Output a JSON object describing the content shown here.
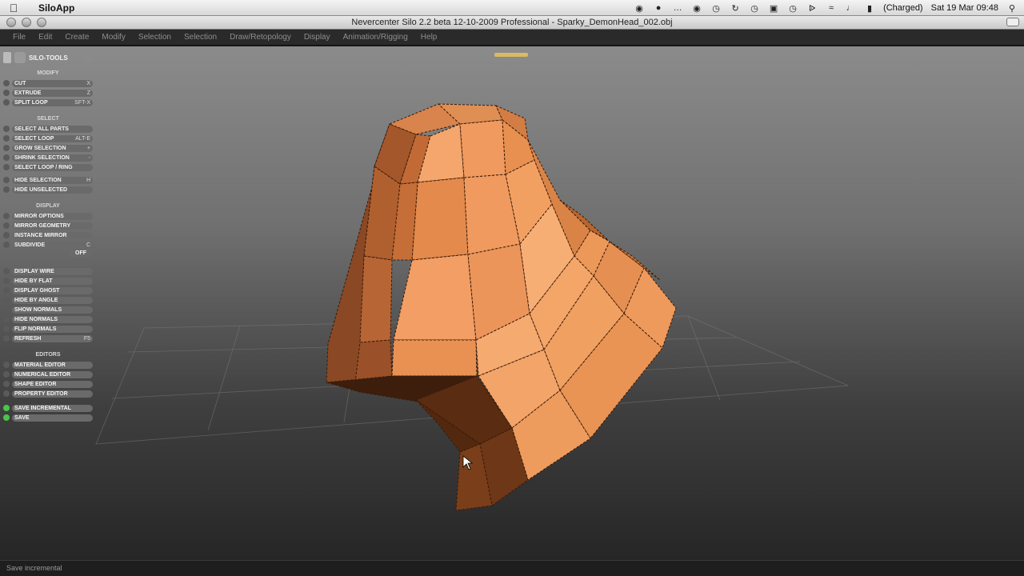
{
  "mac_menubar": {
    "app_name": "SiloApp",
    "status": {
      "battery": "(Charged)",
      "datetime": "Sat 19 Mar  09:48"
    }
  },
  "window": {
    "title": "Nevercenter Silo 2.2 beta 12-10-2009 Professional - Sparky_DemonHead_002.obj"
  },
  "app_menu": {
    "items": [
      "File",
      "Edit",
      "Create",
      "Modify",
      "Selection",
      "Selection",
      "Draw/Retopology",
      "Display",
      "Animation/Rigging",
      "Help"
    ]
  },
  "panel": {
    "title": "SILO-TOOLS",
    "sections": {
      "modify": "MODIFY",
      "select": "SELECT",
      "display": "DISPLAY",
      "editors": "EDITORS"
    },
    "modify_items": [
      {
        "label": "CUT",
        "shortcut": "X"
      },
      {
        "label": "EXTRUDE",
        "shortcut": "Z"
      },
      {
        "label": "SPLIT LOOP",
        "shortcut": "SFT-X"
      }
    ],
    "select_items": [
      {
        "label": "SELECT ALL PARTS",
        "shortcut": ""
      },
      {
        "label": "SELECT LOOP",
        "shortcut": "ALT-E"
      },
      {
        "label": "GROW SELECTION",
        "shortcut": "+"
      },
      {
        "label": "SHRINK SELECTION",
        "shortcut": "-"
      },
      {
        "label": "SELECT LOOP / RING",
        "shortcut": ""
      },
      {
        "label": "HIDE SELECTION",
        "shortcut": "H"
      },
      {
        "label": "HIDE UNSELECTED",
        "shortcut": ""
      }
    ],
    "mirror_items": [
      {
        "label": "MIRROR OPTIONS",
        "shortcut": ""
      },
      {
        "label": "MIRROR GEOMETRY",
        "shortcut": ""
      },
      {
        "label": "INSTANCE MIRROR",
        "shortcut": ""
      },
      {
        "label": "SUBDIVIDE",
        "shortcut": "C"
      }
    ],
    "off_label": "OFF",
    "display_items": [
      {
        "label": "DISPLAY WIRE",
        "shortcut": ""
      },
      {
        "label": "HIDE BY FLAT",
        "shortcut": ""
      },
      {
        "label": "DISPLAY GHOST",
        "shortcut": ""
      },
      {
        "label": "HIDE BY ANGLE",
        "shortcut": ""
      },
      {
        "label": "SHOW NORMALS",
        "shortcut": ""
      },
      {
        "label": "HIDE NORMALS",
        "shortcut": ""
      },
      {
        "label": "FLIP NORMALS",
        "shortcut": ""
      },
      {
        "label": "REFRESH",
        "shortcut": "F5"
      }
    ],
    "editor_items": [
      {
        "label": "MATERIAL EDITOR",
        "shortcut": ""
      },
      {
        "label": "NUMERICAL EDITOR",
        "shortcut": ""
      },
      {
        "label": "SHAPE EDITOR",
        "shortcut": ""
      },
      {
        "label": "PROPERTY EDITOR",
        "shortcut": ""
      }
    ],
    "bottom_items": [
      {
        "label": "SAVE INCREMENTAL",
        "shortcut": ""
      },
      {
        "label": "SAVE",
        "shortcut": ""
      }
    ]
  },
  "status_bar": {
    "text": "Save incremental"
  },
  "colors": {
    "mesh_light": "#f4a46a",
    "mesh_mid": "#d9834a",
    "mesh_dark": "#7a3f1e",
    "accent_green": "#4bc44b"
  }
}
